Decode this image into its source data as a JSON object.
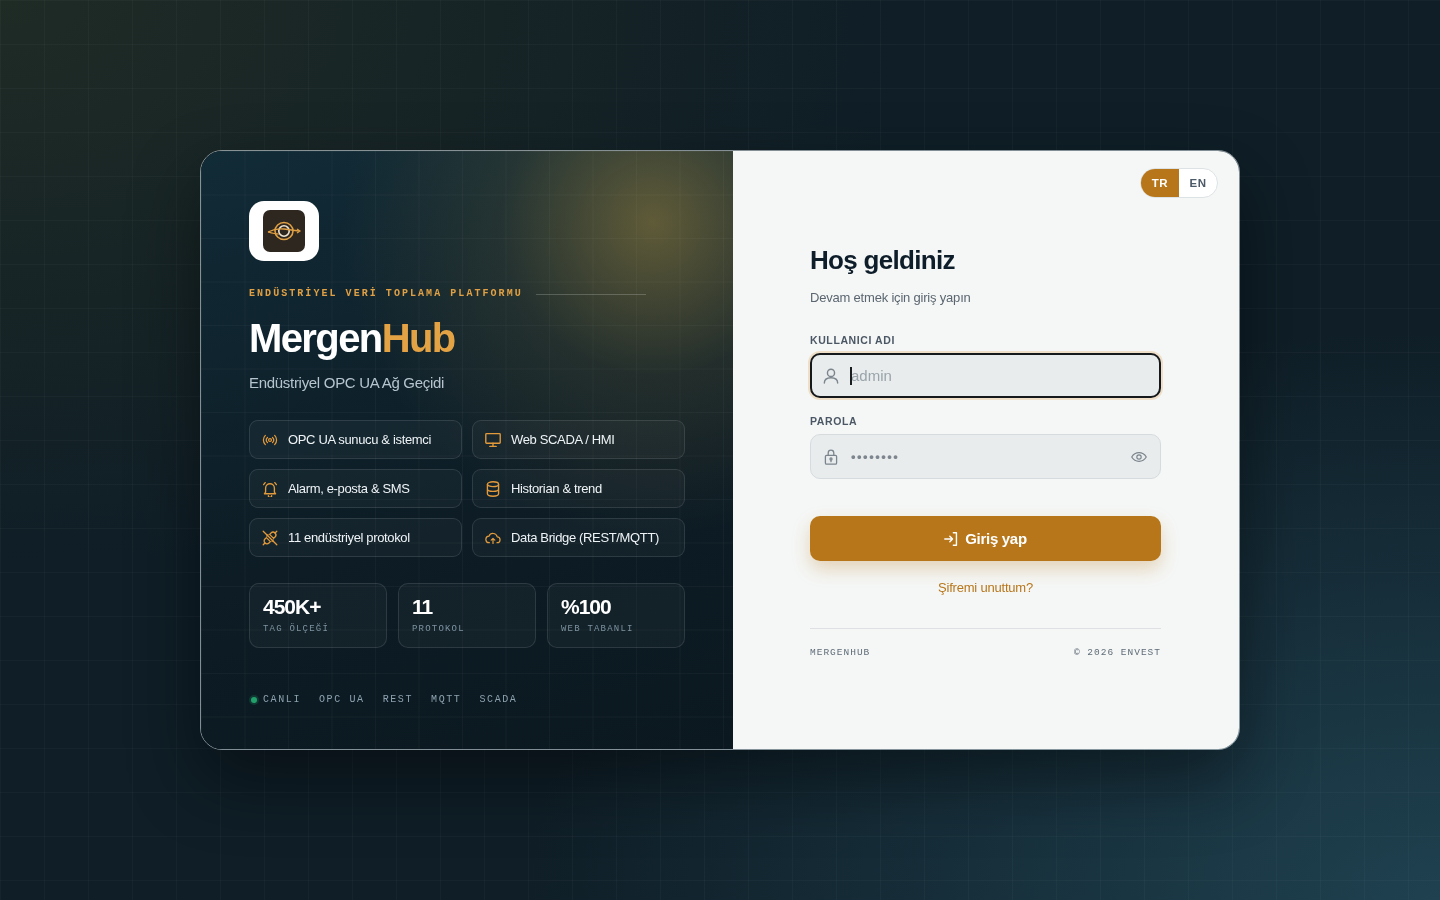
{
  "brand": {
    "tagline": "ENDÜSTRİYEL VERİ TOPLAMA PLATFORMU",
    "name": [
      {
        "text": "Mergen",
        "kind": "plain"
      },
      {
        "text": "Hub",
        "kind": "accent"
      }
    ],
    "subtitle": "Endüstriyel OPC UA Ağ Geçidi"
  },
  "features": [
    {
      "label": "OPC UA sunucu & istemci"
    },
    {
      "label": "Web SCADA / HMI"
    },
    {
      "label": "Alarm, e-posta & SMS"
    },
    {
      "label": "Historian & trend"
    },
    {
      "label": "11 endüstriyel protokol"
    },
    {
      "label": "Data Bridge (REST/MQTT)"
    }
  ],
  "stats": [
    {
      "value": "450K+",
      "label": "TAG ÖLÇEĞİ"
    },
    {
      "value": "11",
      "label": "PROTOKOL"
    },
    {
      "value": "%100",
      "label": "WEB TABANLI"
    }
  ],
  "status": {
    "label": "CANLI",
    "live": true
  },
  "protocols": [
    "OPC UA",
    "REST",
    "MQTT",
    "SCADA"
  ],
  "language_toggle": [
    {
      "label": "TR",
      "selected": true
    },
    {
      "label": "EN",
      "selected": false
    }
  ],
  "login": {
    "title": "Hoş geldiniz",
    "subtitle": "Devam etmek için giriş yapın",
    "fields": [
      {
        "kind": "text",
        "label": "KULLANICI ADI",
        "placeholder": "admin",
        "focused": true
      },
      {
        "kind": "password",
        "label": "PAROLA",
        "value": "••••••••",
        "focused": false
      }
    ],
    "submit": "Giriş yap",
    "forgot_link": "Şifremi unuttum?"
  },
  "footer": {
    "brand": "MERGENHUB",
    "copyright": "© 2026 ENVEST"
  }
}
